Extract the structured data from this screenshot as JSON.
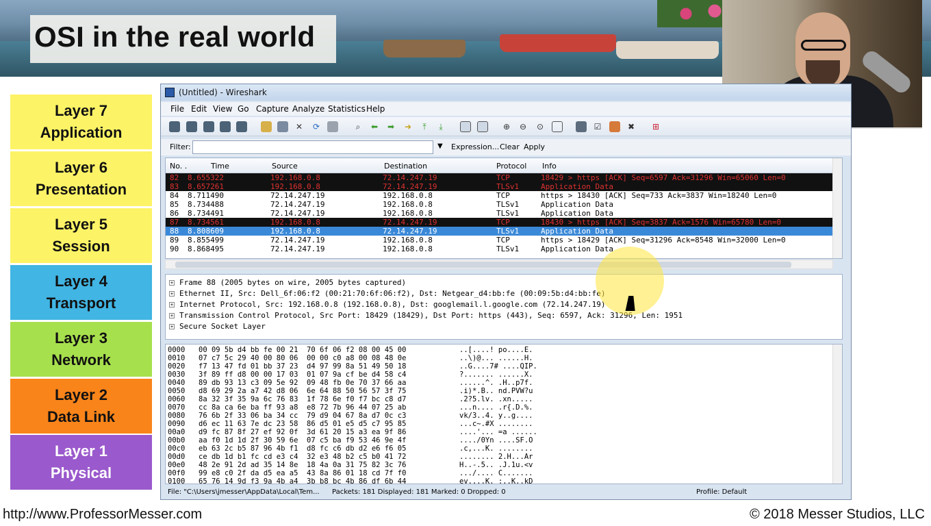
{
  "slide": {
    "title": "OSI in the real world",
    "footer_url": "http://www.ProfessorMesser.com",
    "footer_copyright": "© 2018 Messer Studios, LLC"
  },
  "layers": [
    {
      "num": "Layer 7",
      "name": "Application",
      "color": "#fdf366"
    },
    {
      "num": "Layer 6",
      "name": "Presentation",
      "color": "#fdf366"
    },
    {
      "num": "Layer 5",
      "name": "Session",
      "color": "#fdf366"
    },
    {
      "num": "Layer 4",
      "name": "Transport",
      "color": "#41b5e3"
    },
    {
      "num": "Layer 3",
      "name": "Network",
      "color": "#a7e04d"
    },
    {
      "num": "Layer 2",
      "name": "Data Link",
      "color": "#f9841a"
    },
    {
      "num": "Layer 1",
      "name": "Physical",
      "color": "#9a59cc"
    }
  ],
  "wireshark": {
    "title": "(Untitled) - Wireshark",
    "menu": [
      "File",
      "Edit",
      "View",
      "Go",
      "Capture",
      "Analyze",
      "Statistics",
      "Help"
    ],
    "filter": {
      "label": "Filter:",
      "value": "",
      "expression": "Expression...",
      "clear": "Clear",
      "apply": "Apply"
    },
    "columns": [
      "No. .",
      "Time",
      "Source",
      "Destination",
      "Protocol",
      "Info"
    ],
    "packets": [
      {
        "no": "82",
        "time": "8.655322",
        "src": "192.168.0.8",
        "dst": "72.14.247.19",
        "proto": "TCP",
        "info": "18429 > https [ACK] Seq=6597 Ack=31296 Win=65060 Len=0",
        "style": "black"
      },
      {
        "no": "83",
        "time": "8.657261",
        "src": "192.168.0.8",
        "dst": "72.14.247.19",
        "proto": "TLSv1",
        "info": "Application Data",
        "style": "black"
      },
      {
        "no": "84",
        "time": "8.711490",
        "src": "72.14.247.19",
        "dst": "192.168.0.8",
        "proto": "TCP",
        "info": "https > 18430 [ACK] Seq=733 Ack=3837 Win=18240 Len=0",
        "style": "white"
      },
      {
        "no": "85",
        "time": "8.734488",
        "src": "72.14.247.19",
        "dst": "192.168.0.8",
        "proto": "TLSv1",
        "info": "Application Data",
        "style": "white"
      },
      {
        "no": "86",
        "time": "8.734491",
        "src": "72.14.247.19",
        "dst": "192.168.0.8",
        "proto": "TLSv1",
        "info": "Application Data",
        "style": "white"
      },
      {
        "no": "87",
        "time": "8.734561",
        "src": "192.168.0.8",
        "dst": "72.14.247.19",
        "proto": "TCP",
        "info": "18430 > https [ACK] Seq=3837 Ack=1576 Win=65780 Len=0",
        "style": "black"
      },
      {
        "no": "88",
        "time": "8.808609",
        "src": "192.168.0.8",
        "dst": "72.14.247.19",
        "proto": "TLSv1",
        "info": "Application Data",
        "style": "selected"
      },
      {
        "no": "89",
        "time": "8.855499",
        "src": "72.14.247.19",
        "dst": "192.168.0.8",
        "proto": "TCP",
        "info": "https > 18429 [ACK] Seq=31296 Ack=8548 Win=32000 Len=0",
        "style": "white"
      },
      {
        "no": "90",
        "time": "8.868495",
        "src": "72.14.247.19",
        "dst": "192.168.0.8",
        "proto": "TLSv1",
        "info": "Application Data",
        "style": "white"
      }
    ],
    "details": [
      "Frame 88 (2005 bytes on wire, 2005 bytes captured)",
      "Ethernet II, Src: Dell_6f:06:f2 (00:21:70:6f:06:f2), Dst: Netgear_d4:bb:fe (00:09:5b:d4:bb:fe)",
      "Internet Protocol, Src: 192.168.0.8 (192.168.0.8), Dst: googlemail.l.google.com (72.14.247.19)",
      "Transmission Control Protocol, Src Port: 18429 (18429), Dst Port: https (443), Seq: 6597, Ack: 31296, Len: 1951",
      "Secure Socket Layer"
    ],
    "hex": [
      {
        "off": "0000",
        "bytes": "00 09 5b d4 bb fe 00 21  70 6f 06 f2 08 00 45 00",
        "ascii": "..[....! po....E."
      },
      {
        "off": "0010",
        "bytes": "07 c7 5c 29 40 00 80 06  00 00 c0 a8 00 08 48 0e",
        "ascii": "..\\)@... ......H."
      },
      {
        "off": "0020",
        "bytes": "f7 13 47 fd 01 bb 37 23  d4 97 99 8a 51 49 50 18",
        "ascii": "..G....7# ....QIP."
      },
      {
        "off": "0030",
        "bytes": "3f 89 ff d8 00 00 17 03  01 07 9a cf be d4 58 c4",
        "ascii": "?....... ......X."
      },
      {
        "off": "0040",
        "bytes": "89 db 93 13 c3 09 5e 92  09 48 fb 0e 70 37 66 aa",
        "ascii": "......^. .H..p7f."
      },
      {
        "off": "0050",
        "bytes": "d8 69 29 2a a7 42 d8 06  6e 64 88 50 56 57 3f 75",
        "ascii": ".i)*.B.. nd.PVW?u"
      },
      {
        "off": "0060",
        "bytes": "8a 32 3f 35 9a 6c 76 83  1f 78 6e f0 f7 bc c8 d7",
        "ascii": ".2?5.lv. .xn....."
      },
      {
        "off": "0070",
        "bytes": "cc 8a ca 6e ba ff 93 a8  e8 72 7b 96 44 07 25 ab",
        "ascii": "...n.... .r{.D.%."
      },
      {
        "off": "0080",
        "bytes": "76 6b 2f 33 06 ba 34 cc  79 d9 04 67 8a d7 0c c3",
        "ascii": "vk/3..4. y..g...."
      },
      {
        "off": "0090",
        "bytes": "d6 ec 11 63 7e dc 23 58  86 d5 01 e5 d5 c7 95 85",
        "ascii": "...c~.#X ........"
      },
      {
        "off": "00a0",
        "bytes": "d9 fc 87 8f 27 ef 92 0f  3d 61 20 15 a3 ea 9f 86",
        "ascii": "....'... =a ......"
      },
      {
        "off": "00b0",
        "bytes": "aa f0 1d 1d 2f 30 59 6e  07 c5 ba f9 53 46 9e 4f",
        "ascii": "..../0Yn ....SF.O"
      },
      {
        "off": "00c0",
        "bytes": "eb 63 2c b5 87 96 4b f1  d8 fc c6 db d2 e6 f6 05",
        "ascii": ".c,...K. ........"
      },
      {
        "off": "00d0",
        "bytes": "ce db 1d b1 fc cd e3 c4  32 e3 48 b2 c5 b0 41 72",
        "ascii": "........ 2.H...Ar"
      },
      {
        "off": "00e0",
        "bytes": "48 2e 91 2d ad 35 14 8e  18 4a 0a 31 75 82 3c 76",
        "ascii": "H..-.5.. .J.1u.<v"
      },
      {
        "off": "00f0",
        "bytes": "99 e8 c0 2f da d5 ea a5  43 8a 86 01 18 cd 7f f0",
        "ascii": ".../.... C......."
      },
      {
        "off": "0100",
        "bytes": "65 76 14 9d f3 9a 4b a4  3b b8 bc 4b 86 df 6b 44",
        "ascii": "ev....K. ;..K..kD"
      }
    ],
    "status": {
      "file": "File: \"C:\\Users\\jmesser\\AppData\\Local\\Tem...",
      "packets": "Packets: 181 Displayed: 181 Marked: 0 Dropped: 0",
      "profile": "Profile: Default"
    }
  }
}
